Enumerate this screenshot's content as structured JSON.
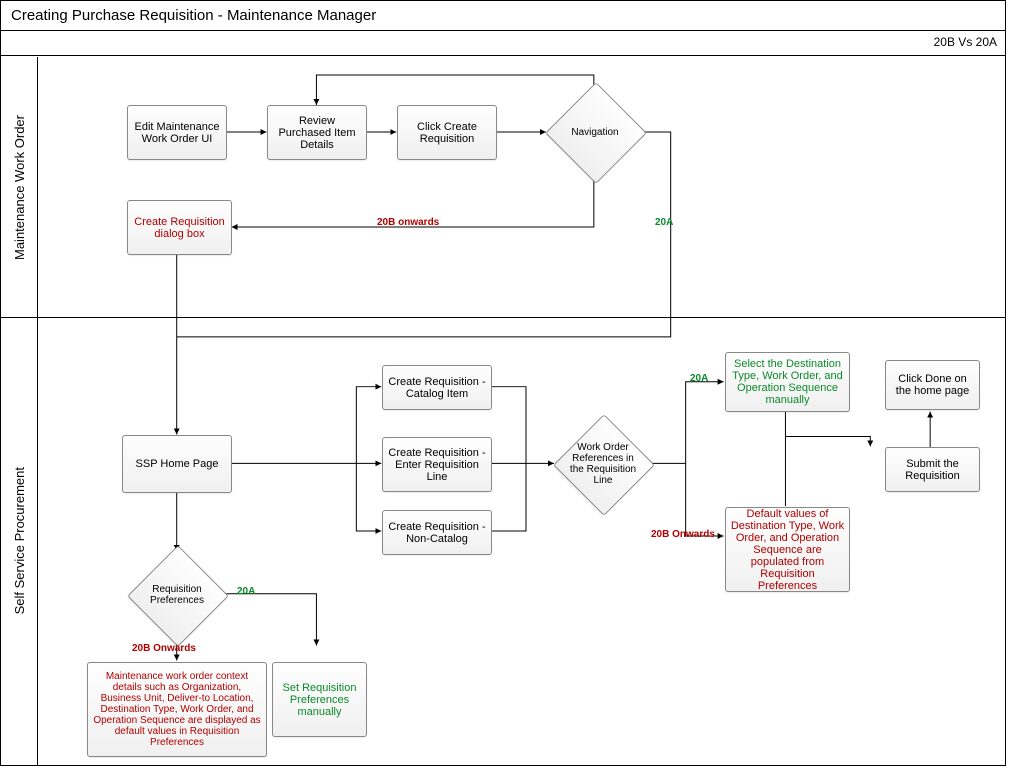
{
  "title": "Creating Purchase Requisition - Maintenance Manager",
  "subtitle_right": "20B Vs 20A",
  "lanes": {
    "mwo": "Maintenance Work Order",
    "ssp": "Self Service Procurement"
  },
  "nodes": {
    "edit_wo": "Edit Maintenance Work Order UI",
    "review_item": "Review Purchased Item Details",
    "click_create": "Click Create Requisition",
    "nav": "Navigation",
    "create_dialog": "Create Requisition dialog  box",
    "ssp_home": "SSP Home Page",
    "req_prefs": "Requisition Preferences",
    "mwo_context": "Maintenance work order context details such as Organization, Business Unit, Deliver-to Location, Destination Type, Work Order, and Operation Sequence are displayed as default values in Requisition Preferences",
    "set_prefs": "Set Requisition Preferences manually",
    "cr_catalog": "Create Requisition  - Catalog Item",
    "cr_enter_line": "Create Requisition  - Enter Requisition Line",
    "cr_noncat": "Create Requisition  - Non-Catalog",
    "wo_refs": "Work Order References in the Requisition Line",
    "select_dest": "Select the Destination Type, Work Order, and Operation Sequence manually",
    "default_vals": "Default values of Destination Type, Work Order, and Operation Sequence are populated from Requisition Preferences",
    "submit": "Submit the Requisition",
    "click_done": "Click Done on the home page"
  },
  "edge_labels": {
    "twentyA": "20A",
    "twentyB_onwards1": "20B onwards",
    "twentyB_onwards2": "20B Onwards",
    "twentyB_onwards3": "20B Onwards"
  }
}
